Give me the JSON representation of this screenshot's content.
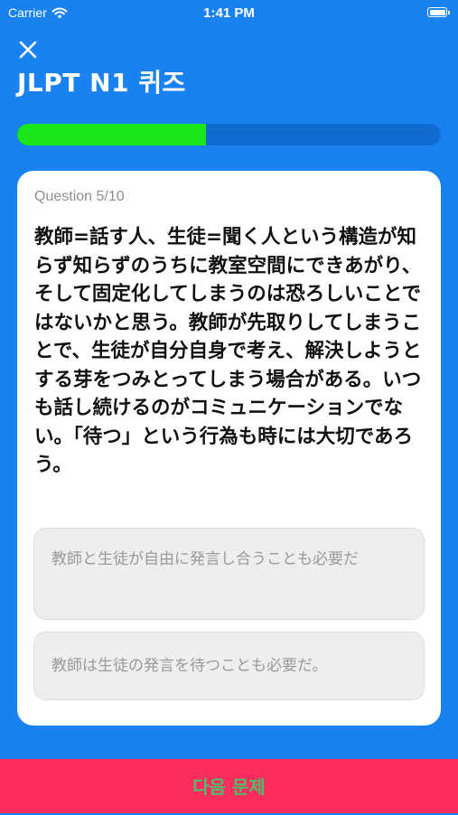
{
  "status_bar": {
    "carrier": "Carrier",
    "time": "1:41 PM"
  },
  "header": {
    "title": "JLPT N1 퀴즈",
    "close_icon": "close-icon"
  },
  "progress": {
    "fraction": 0.445,
    "fill_color": "#1be61b",
    "track_color": "#0f6bd0"
  },
  "question": {
    "number_label": "Question 5/10",
    "text": "教師=話す人、生徒=聞く人という構造が知らず知らずのうちに教室空間にできあがり、そして固定化してしまうのは恐ろしいことではないかと思う。教師が先取りしてしまうことで、生徒が自分自身で考え、解決しようとする芽をつみとってしまう場合がある。いつも話し続けるのがコミュニケーションでない。「待つ」という行為も時には大切であろう。"
  },
  "options": [
    "教師と生徒が自由に発言し合うことも必要だ",
    "教師は生徒の発言を待つことも必要だ。"
  ],
  "footer": {
    "next_label": "다음 문제"
  },
  "colors": {
    "background": "#1a82f0",
    "next_button": "#fb2d5f",
    "next_button_text": "#4ebc6b"
  }
}
